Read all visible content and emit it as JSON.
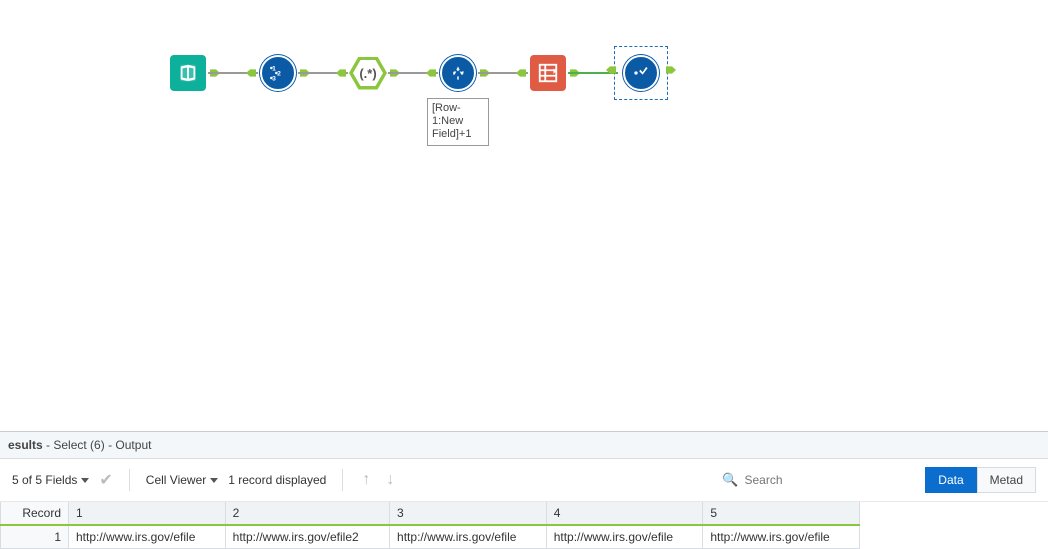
{
  "canvas": {
    "tools": [
      {
        "name": "text-input-tool",
        "label": ""
      },
      {
        "name": "record-id-tool",
        "label": "123"
      },
      {
        "name": "regex-tool",
        "label": "(.*)"
      },
      {
        "name": "multi-row-formula-tool",
        "label": "",
        "annotation": "[Row-1:New Field]+1"
      },
      {
        "name": "crosstab-tool",
        "label": ""
      },
      {
        "name": "browse-tool",
        "label": "",
        "selected": true
      }
    ]
  },
  "results": {
    "header": {
      "title": "esults",
      "path1": "Select (6)",
      "path2": "Output"
    },
    "toolbar": {
      "fields_label": "5 of 5 Fields",
      "cell_viewer_label": "Cell Viewer",
      "records_label": "1 record displayed",
      "search_placeholder": "Search",
      "tab_data": "Data",
      "tab_metadata": "Metad"
    },
    "grid": {
      "columns": [
        "Record",
        "1",
        "2",
        "3",
        "4",
        "5"
      ],
      "rows": [
        {
          "record": "1",
          "cells": [
            "http://www.irs.gov/efile",
            "http://www.irs.gov/efile2",
            "http://www.irs.gov/efile",
            "http://www.irs.gov/efile",
            "http://www.irs.gov/efile"
          ]
        }
      ]
    }
  }
}
